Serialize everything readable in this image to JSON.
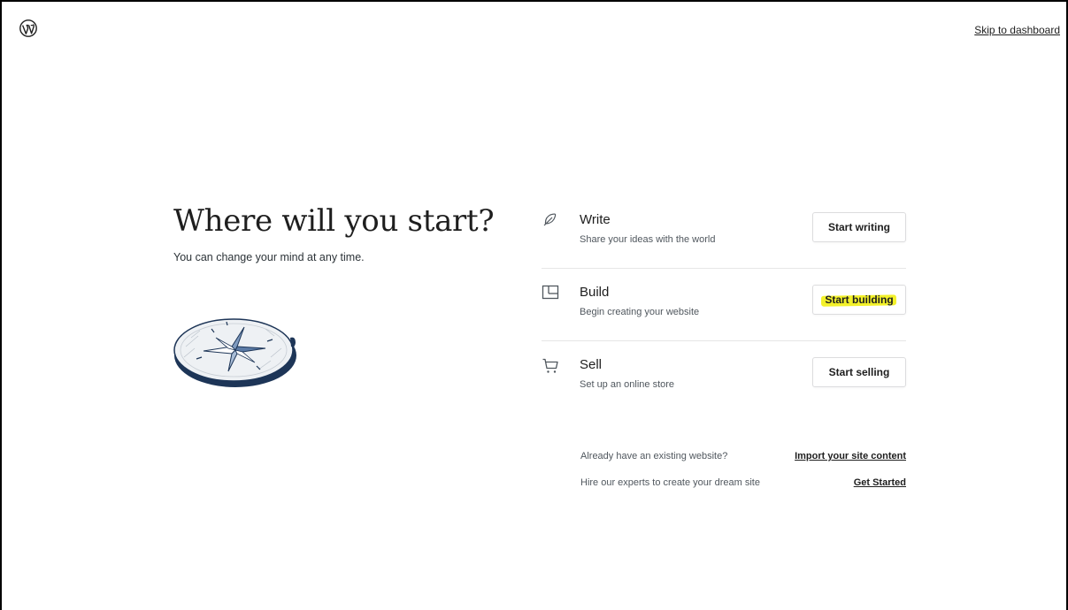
{
  "header": {
    "logo_icon": "wordpress-logo-icon",
    "skip_label": "Skip to dashboard"
  },
  "intro": {
    "title": "Where will you start?",
    "subtitle": "You can change your mind at any time.",
    "illustration": "compass-illustration"
  },
  "options": [
    {
      "icon": "feather-icon",
      "title": "Write",
      "description": "Share your ideas with the world",
      "button": "Start writing"
    },
    {
      "icon": "layout-icon",
      "title": "Build",
      "description": "Begin creating your website",
      "button": "Start building",
      "highlighted": true
    },
    {
      "icon": "cart-icon",
      "title": "Sell",
      "description": "Set up an online store",
      "button": "Start selling"
    }
  ],
  "footer": {
    "import_label": "Already have an existing website?",
    "import_link": "Import your site content",
    "hire_label": "Hire our experts to create your dream site",
    "hire_link": "Get Started"
  },
  "colors": {
    "text": "#1e1e1e",
    "muted": "#50575e",
    "highlight": "#f3f12a",
    "compass_navy": "#1d3557"
  }
}
